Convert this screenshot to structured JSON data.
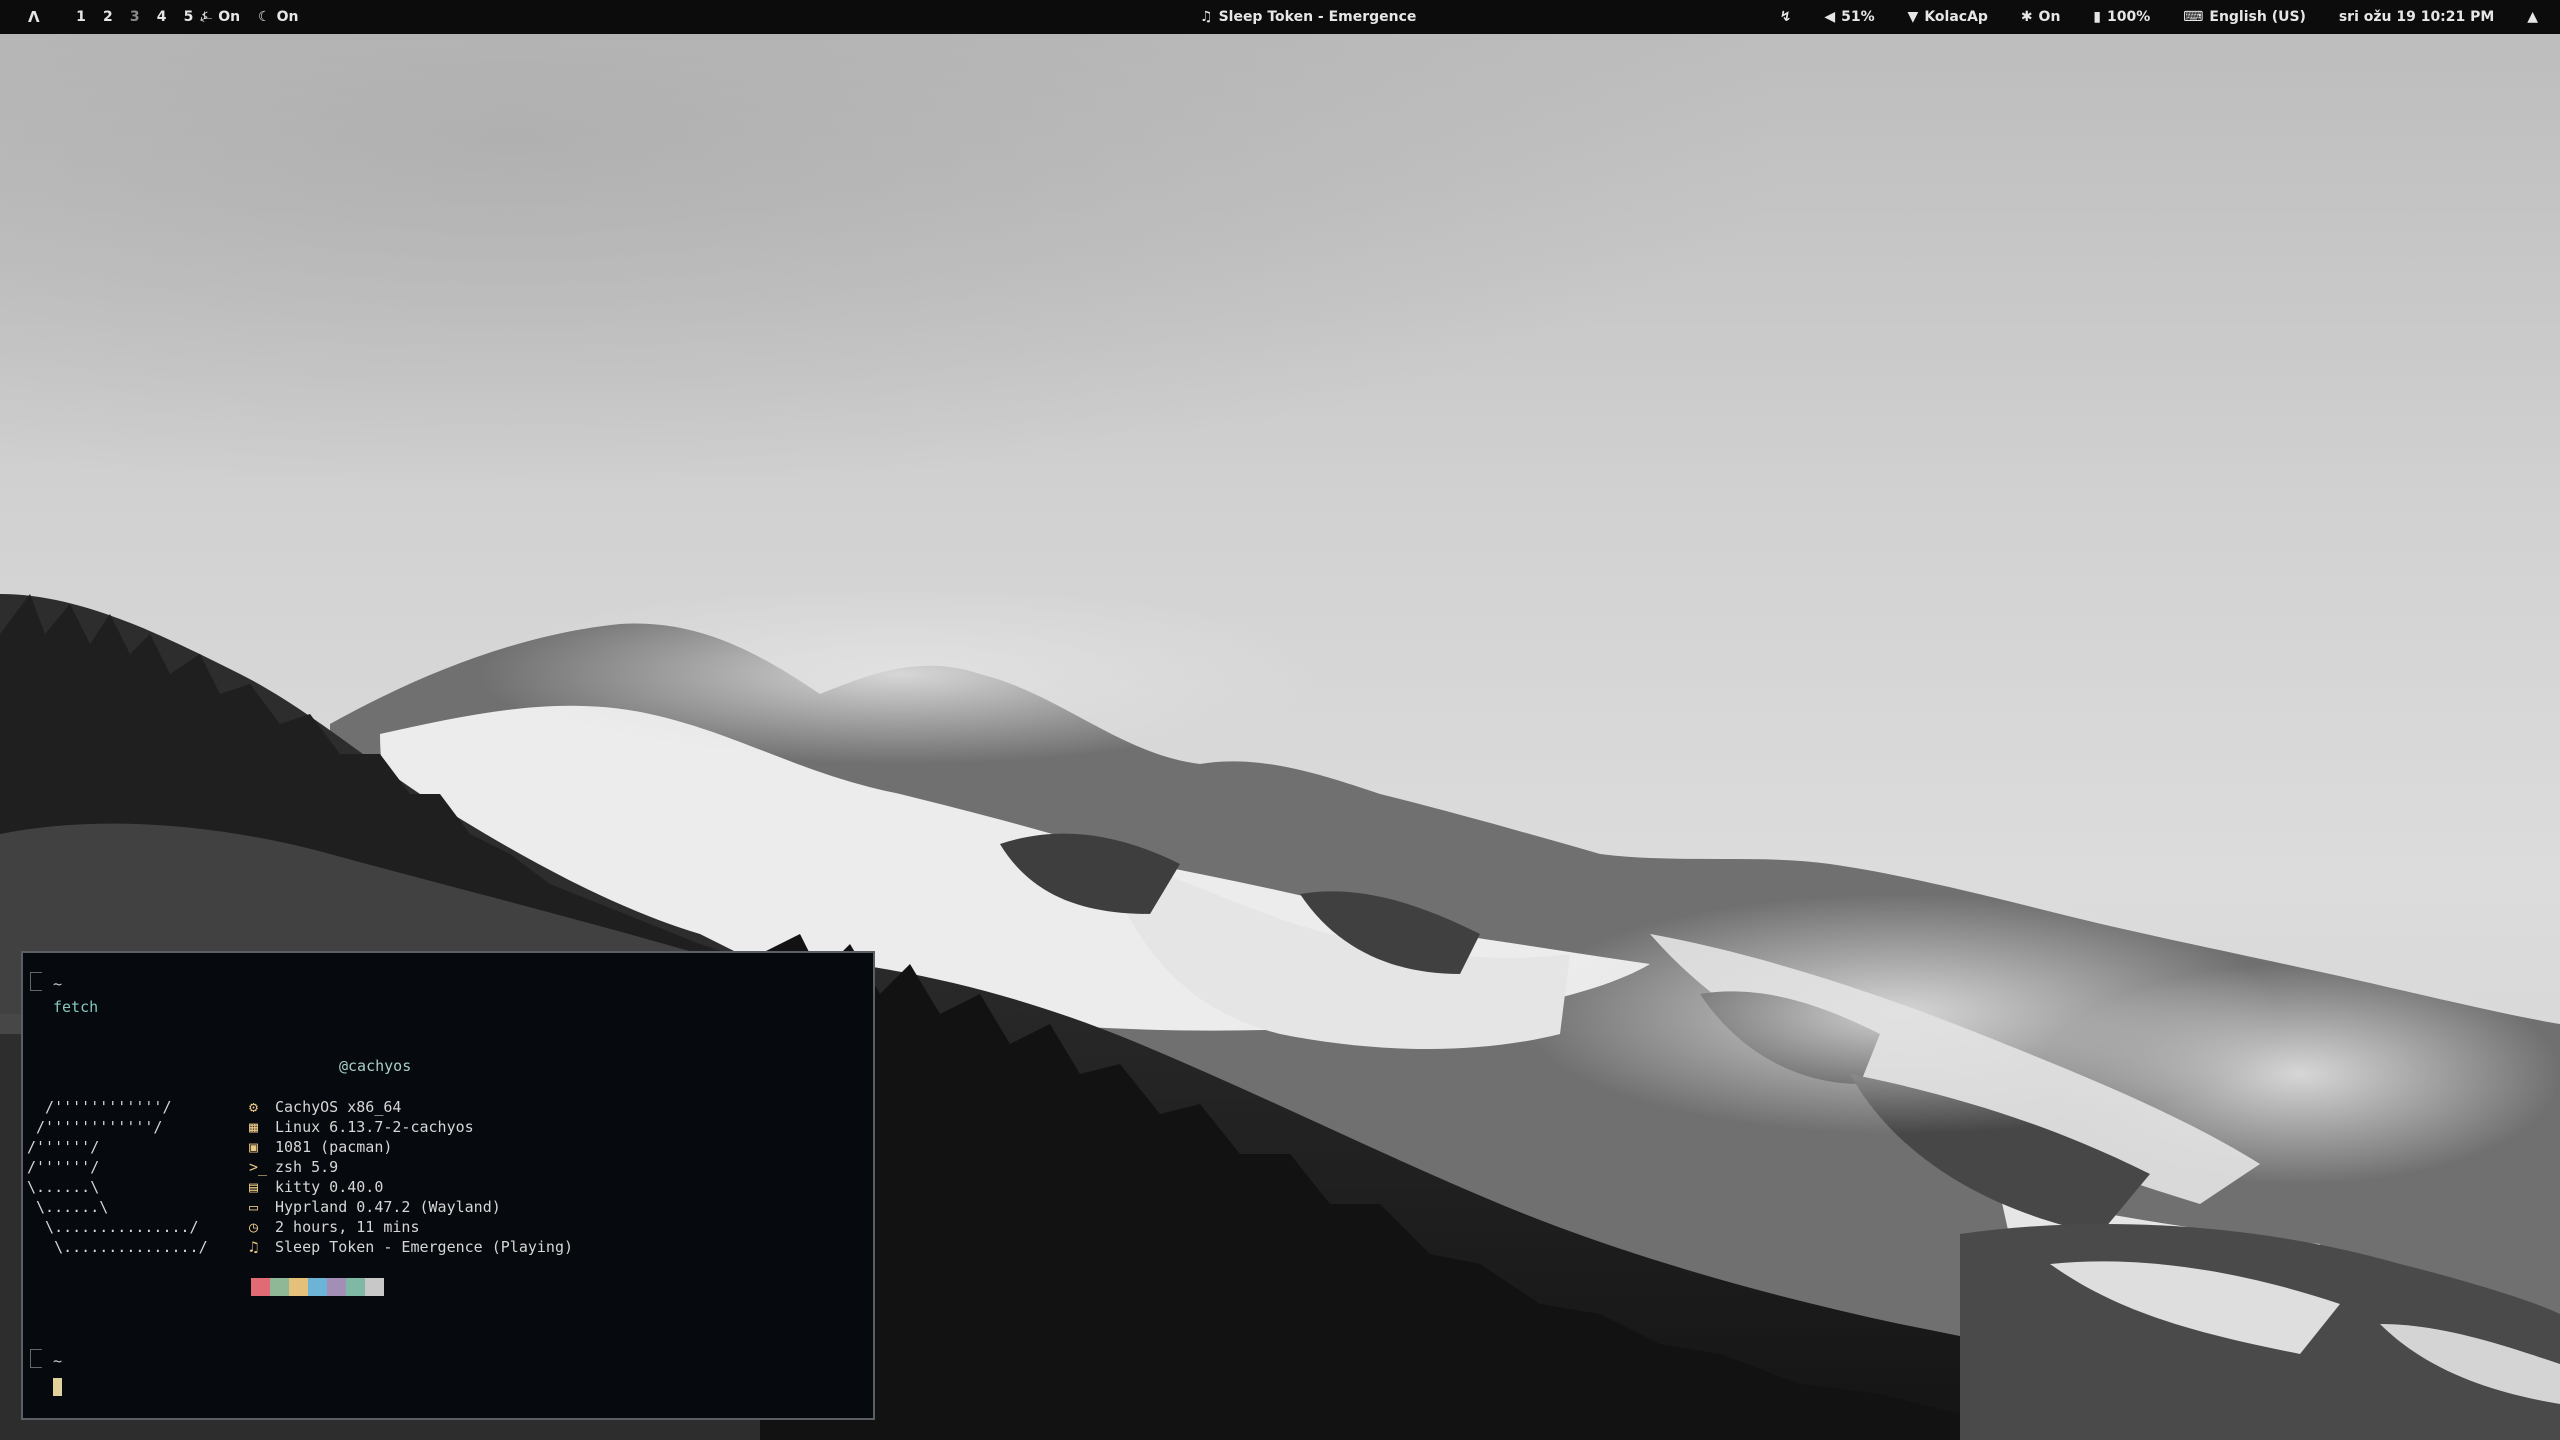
{
  "topbar": {
    "launcher_icon": "arch-logo-icon",
    "launcher_glyph": "Λ",
    "workspaces": [
      "1",
      "2",
      "3",
      "4",
      "5"
    ],
    "active_workspace_dim": "3",
    "idle_inhibit": {
      "icon": "idle-icon",
      "glyph": "⍼",
      "label": "On"
    },
    "caffeine": {
      "icon": "caffeine-icon",
      "glyph": "☾",
      "label": "On"
    },
    "now_playing": {
      "icon": "music-note-icon",
      "glyph": "♫",
      "label": "Sleep Token - Emergence"
    },
    "hyprsunset": {
      "icon": "sunset-icon",
      "glyph": "↯"
    },
    "volume": {
      "icon": "speaker-icon",
      "glyph": "◀",
      "label": "51%"
    },
    "wifi": {
      "icon": "wifi-icon",
      "glyph": "▼",
      "label": "KolacAp"
    },
    "bluetooth": {
      "icon": "bluetooth-icon",
      "glyph": "✱",
      "label": "On"
    },
    "battery": {
      "icon": "battery-icon",
      "glyph": "▮",
      "label": "100%"
    },
    "keyboard": {
      "icon": "keyboard-icon",
      "glyph": "⌨",
      "label": "English (US)"
    },
    "clock": {
      "label": "sri ožu 19  10:21 PM"
    },
    "notifications": {
      "icon": "bell-icon",
      "glyph": "▲"
    }
  },
  "terminal": {
    "tilde_top": "~",
    "command": "fetch",
    "user_host": "@cachyos",
    "ascii_logo": "  /''''''''''''/\n /''''''''''''/\n/''''''/\n/''''''/\n\\......\\\n \\......\\\n  \\.............../\n   \\.............../",
    "info": [
      {
        "icon": "os-gear-icon",
        "glyph": "⚙",
        "value": "CachyOS x86_64"
      },
      {
        "icon": "kernel-icon",
        "glyph": "▦",
        "value": "Linux 6.13.7-2-cachyos"
      },
      {
        "icon": "package-icon",
        "glyph": "▣",
        "value": "1081 (pacman)"
      },
      {
        "icon": "shell-icon",
        "glyph": ">_",
        "value": "zsh 5.9"
      },
      {
        "icon": "terminal-icon",
        "glyph": "▤",
        "value": "kitty 0.40.0"
      },
      {
        "icon": "window-manager-icon",
        "glyph": "▭",
        "value": "Hyprland 0.47.2 (Wayland)"
      },
      {
        "icon": "clock-icon",
        "glyph": "◷",
        "value": "2 hours, 11 mins"
      },
      {
        "icon": "music-icon",
        "glyph": "♫",
        "value": "Sleep Token - Emergence (Playing)"
      }
    ],
    "palette": [
      "#e06b74",
      "#8fb897",
      "#e5c07b",
      "#6cb3d6",
      "#a38fb5",
      "#7fb8a4",
      "#c8c8c8"
    ],
    "tilde_bottom": "~"
  },
  "colors": {
    "bar_bg": "#0c0c0c",
    "terminal_bg": "#06090d",
    "accent_icon": "#e8c686"
  }
}
